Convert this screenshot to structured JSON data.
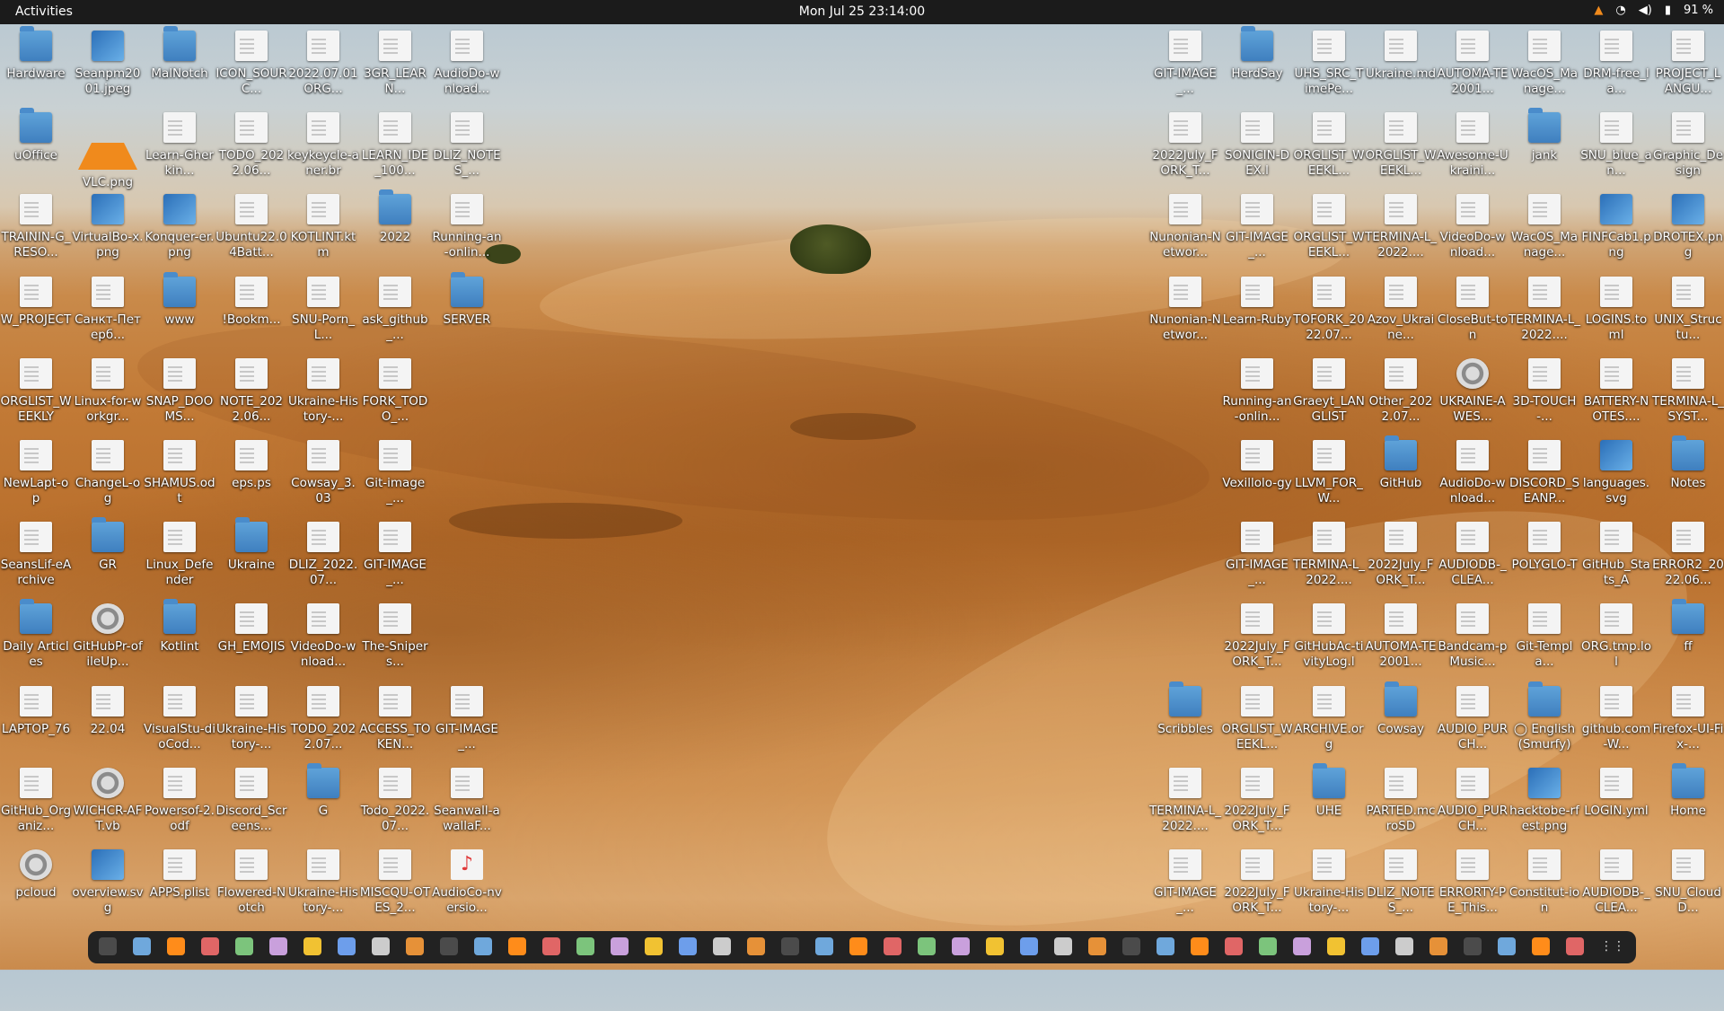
{
  "topbar": {
    "activities": "Activities",
    "clock": "Mon Jul 25  23:14:00",
    "tray": {
      "vlc_icon": "vlc-cone-icon",
      "wifi_icon": "wifi-icon",
      "volume_icon": "volume-icon",
      "battery_icon": "battery-icon",
      "battery_percent": "91 %"
    }
  },
  "colors": {
    "topbar": "#1b1b1b",
    "folder": "#4a8ccb",
    "dock": "#222222"
  },
  "desktop": {
    "left_columns": [
      [
        "Hardware",
        "uOffice",
        "TRAININ-G_RESO...",
        "W_PROJECT",
        "ORGLIST_WEEKLY",
        "NewLapt-op",
        "SeansLif-eArchive",
        "Daily Articles",
        "LAPTOP_76",
        "GitHub_Organiz...",
        "pcloud"
      ],
      [
        "Seanpm2001.jpeg",
        "VLC.png",
        "VirtualBo-x.png",
        "Санкт-Петерб...",
        "Linux-for-workgr...",
        "ChangeL-og",
        "GR",
        "GitHubPr-ofileUp...",
        "22.04",
        "WICHCR-AFT.vb",
        "overview.svg"
      ],
      [
        "MalNotch",
        "Learn-Gherkin...",
        "Konquer-er.png",
        "www",
        "SNAP_DOOMS...",
        "SHAMUS.odt",
        "Linux_Defender",
        "Kotlint",
        "VisualStu-dioCod...",
        "Powersof-2.odf",
        "APPS.plist"
      ],
      [
        "ICON_SOURC...",
        "TODO_2022.06...",
        "Ubuntu22.04Batt...",
        "!Bookm...",
        "NOTE_2022.06...",
        "eps.ps",
        "Ukraine",
        "GH_EMOJIS",
        "Ukraine-History-...",
        "Discord_Screens...",
        "Flowered-Notch"
      ],
      [
        "2022.07.01ORG...",
        "keykeycle-aner.br",
        "KOTLINT.ktm",
        "SNU-Porn_L...",
        "Ukraine-History-...",
        "Cowsay_3.03",
        "DLIZ_2022.07...",
        "VideoDo-wnload...",
        "TODO_2022.07...",
        "G",
        "Ukraine-History-..."
      ],
      [
        "3GR_LEARN...",
        "LEARN_IDE_100...",
        "2022",
        "ask_github_...",
        "FORK_TODO_...",
        "Git-image_...",
        "GIT-IMAGE_...",
        "The-Snipers...",
        "ACCESS_TOKEN...",
        "Todo_2022.07...",
        "MISCQU-OTES_2..."
      ],
      [
        "AudioDo-wnload...",
        "DLIZ_NOTES_...",
        "Running-an-onlin...",
        "SERVER",
        "",
        "",
        "",
        "",
        "GIT-IMAGE_...",
        "Seanwall-awallaF...",
        "AudioCo-nversio..."
      ]
    ],
    "right_columns": [
      [
        "GIT-IMAGE_...",
        "2022July_FORK_T...",
        "Nunonian-Networ...",
        "Nunonian-Networ...",
        "",
        "",
        "",
        "",
        "Scribbles",
        "TERMINA-L_2022....",
        "GIT-IMAGE_..."
      ],
      [
        "HerdSay",
        "SONICIN-DEX.l",
        "GIT-IMAGE_...",
        "Learn-Ruby",
        "Running-an-onlin...",
        "Vexillolo-gy",
        "GIT-IMAGE_...",
        "2022July_FORK_T...",
        "ORGLIST_WEEKL...",
        "2022July_FORK_T...",
        "2022July_FORK_T..."
      ],
      [
        "UHS_SRC_TimePe...",
        "ORGLIST_WEEKL...",
        "ORGLIST_WEEKL...",
        "TOFORK_2022.07...",
        "Graeyt_LANGLIST",
        "LLVM_FOR_W...",
        "TERMINA-L_2022....",
        "GitHubAc-tivityLog.l",
        "ARCHIVE.org",
        "UHE",
        "Ukraine-History-..."
      ],
      [
        "Ukraine.md",
        "ORGLIST_WEEKL...",
        "TERMINA-L_2022....",
        "Azov_Ukraine...",
        "Other_2022.07...",
        "GitHub",
        "2022July_FORK_T...",
        "AUTOMA-TE2001...",
        "Cowsay",
        "PARTED.mcroSD",
        "DLIZ_NOTES_..."
      ],
      [
        "AUTOMA-TE2001...",
        "Awesome-Ukraini...",
        "VideoDo-wnload...",
        "CloseBut-ton",
        "UKRAINE-AWES...",
        "AudioDo-wnload...",
        "AUDIODB-_CLEA...",
        "Bandcam-pMusic...",
        "AUDIO_PURCH...",
        "AUDIO_PURCH...",
        "ERRORTY-PE_This..."
      ],
      [
        "WacOS_Manage...",
        "jank",
        "WacOS_Manage...",
        "TERMINA-L_2022....",
        "3D-TOUCH-...",
        "DISCORD_SEANP...",
        "POLYGLO-T",
        "Git-Templa...",
        "◯ English (Smurfy)",
        "hacktobe-rfest.png",
        "Constitut-ion"
      ],
      [
        "DRM-free_la...",
        "SNU_blue_an...",
        "FINFCab1.png",
        "LOGINS.toml",
        "BATTERY-NOTES....",
        "languages.svg",
        "GitHub_Stats_A",
        "ORG.tmp.lol",
        "github.com-W...",
        "LOGIN.yml",
        "AUDIODB-_CLEA..."
      ],
      [
        "PROJECT_LANGU...",
        "Graphic_Design",
        "DROTEX.png",
        "UNIX_Structu...",
        "TERMINA-L_SYST...",
        "Notes",
        "ERROR2_2022.06...",
        "ff",
        "Firefox-UI-Fix-...",
        "Home",
        "SNU_CloudD..."
      ]
    ]
  },
  "dock": {
    "items": [
      "terminal-icon",
      "files-icon",
      "text-editor-icon",
      "calculator-icon",
      "terminal-2-icon",
      "firefox-icon",
      "vlc-icon",
      "obs-icon",
      "software-icon",
      "notes-icon",
      "writer-icon",
      "help-icon",
      "monitor-icon",
      "document-icon",
      "mouse-icon",
      "virtualbox-icon",
      "github-icon",
      "inkscape-icon",
      "game-icon",
      "gimp-icon",
      "archive-icon",
      "screenshot-icon",
      "chrome-icon",
      "steam-icon",
      "spreadsheet-icon",
      "settings-icon",
      "calc-icon",
      "notes-2-icon",
      "presentation-icon",
      "discord-icon",
      "clock-icon",
      "pdf-icon",
      "vim-icon",
      "todo-icon",
      "scanner-icon",
      "slides-icon",
      "app-icon",
      "dictionary-icon",
      "warning-icon",
      "word-icon",
      "editor-icon",
      "editor-2-icon",
      "tool-icon",
      "apps-icon",
      "show-apps-icon"
    ]
  }
}
